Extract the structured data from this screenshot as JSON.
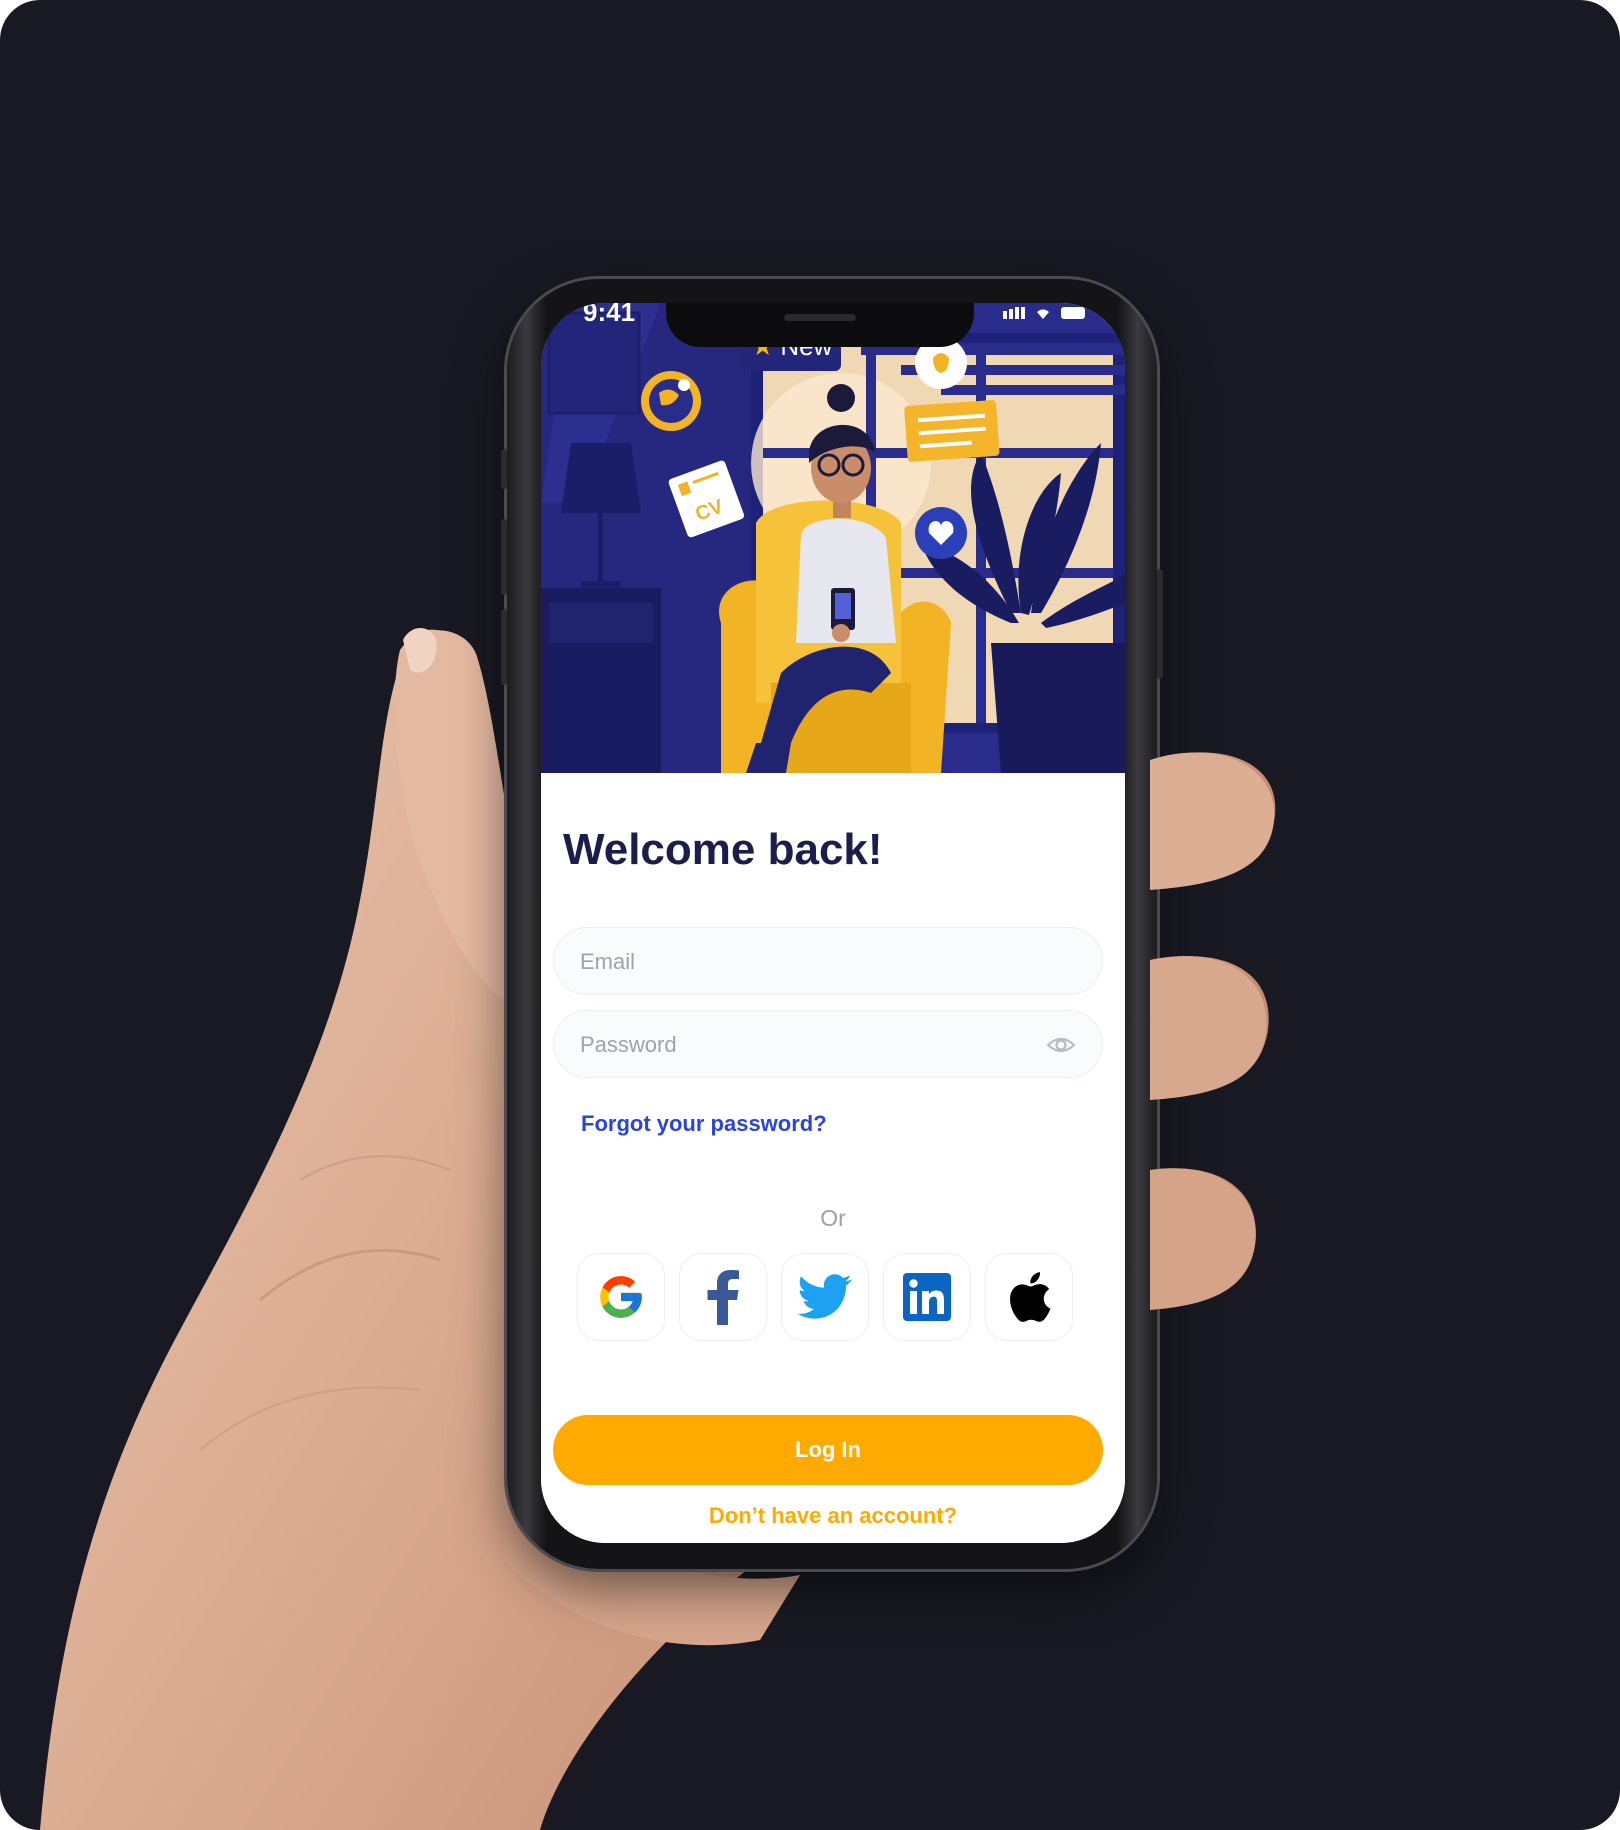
{
  "status_bar": {
    "time": "9:41"
  },
  "illustration": {
    "badge_text": "New",
    "cv_label": "CV"
  },
  "login": {
    "title": "Welcome back!",
    "email_placeholder": "Email",
    "password_placeholder": "Password",
    "forgot_link": "Forgot your password?",
    "or_label": "Or",
    "social_icons": [
      "google-icon",
      "facebook-icon",
      "twitter-icon",
      "linkedin-icon",
      "apple-icon"
    ],
    "login_button": "Log In",
    "signup_link": "Don’t have an account?"
  },
  "colors": {
    "background": "#191923",
    "accent": "#ffaa00",
    "title": "#1b1d4d",
    "link": "#2a45d8",
    "illustration_bg": "#2a2c8c"
  }
}
